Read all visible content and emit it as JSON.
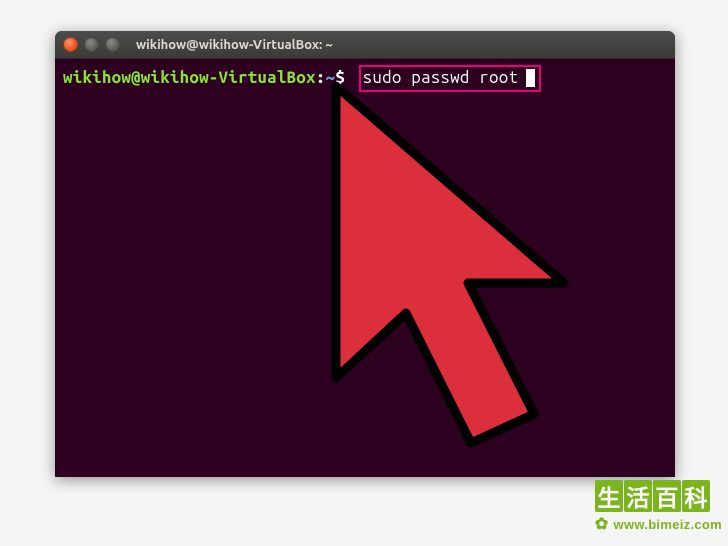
{
  "window": {
    "title": "wikihow@wikihow-VirtualBox: ~"
  },
  "prompt": {
    "user_host": "wikihow@wikihow-VirtualBox",
    "separator": ":",
    "path": "~",
    "symbol": "$"
  },
  "command": {
    "text": "sudo passwd root"
  },
  "watermark": {
    "chars": [
      "生",
      "活",
      "百",
      "科"
    ],
    "url": "www.bimeiz.com"
  }
}
